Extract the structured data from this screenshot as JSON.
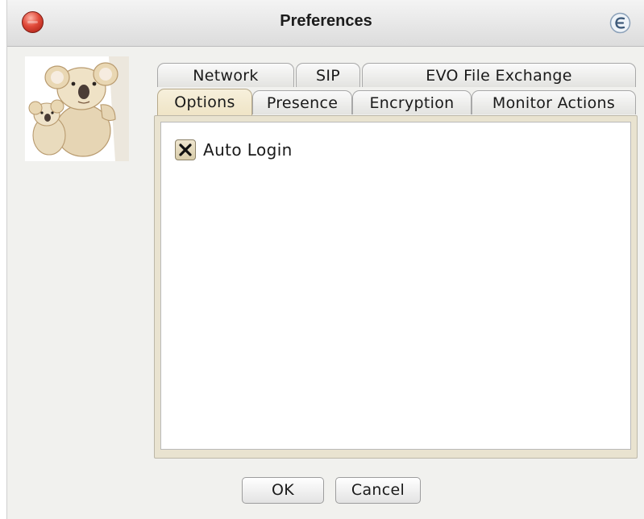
{
  "window": {
    "title": "Preferences"
  },
  "tabs": {
    "row1": [
      {
        "label": "Network"
      },
      {
        "label": "SIP"
      },
      {
        "label": "EVO File Exchange"
      }
    ],
    "row2": [
      {
        "label": "Options",
        "selected": true
      },
      {
        "label": "Presence"
      },
      {
        "label": "Encryption"
      },
      {
        "label": "Monitor Actions"
      }
    ]
  },
  "options": {
    "auto_login": {
      "label": "Auto Login",
      "checked": true
    }
  },
  "buttons": {
    "ok": "OK",
    "cancel": "Cancel"
  },
  "colors": {
    "selected_tab": "#efe4c6",
    "close_button": "#e04a3a",
    "window_bg": "#f1f1ee"
  },
  "icons": {
    "close": "close-icon",
    "app": "evo-e-icon",
    "avatar": "koala-image",
    "check": "check-x-icon"
  }
}
